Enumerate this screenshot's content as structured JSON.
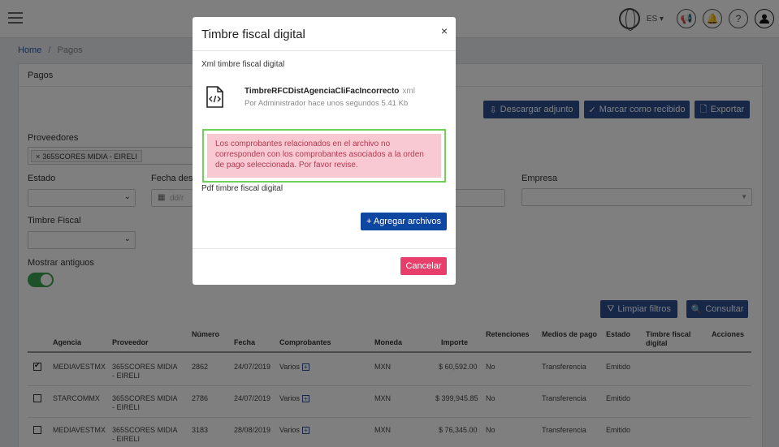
{
  "topbar": {
    "lang": "ES ▾",
    "lang_label": "ES"
  },
  "breadcrumb": {
    "home": "Home",
    "sep": "/",
    "current": "Pagos"
  },
  "panel": {
    "title": "Pagos"
  },
  "actions": {
    "download": "Descargar adjunto",
    "mark_received": "Marcar como recibido",
    "export": "Exportar"
  },
  "filters": {
    "proveedores_label": "Proveedores",
    "proveedor_tag": "365SCORES MIDIA - EIRELI",
    "estado_label": "Estado",
    "fecha_label": "Fecha desd",
    "fecha_placeholder": "dd/r",
    "empresa_label": "Empresa",
    "timbre_label": "Timbre Fiscal",
    "antiguos_label": "Mostrar antiguos",
    "limpiar": "Limpiar filtros",
    "consultar": "Consultar"
  },
  "table": {
    "headers": [
      "Agencia",
      "Proveedor",
      "Número",
      "Fecha",
      "Comprobantes",
      "Moneda",
      "Importe",
      "Retenciones",
      "Medios de pago",
      "Estado",
      "Timbre fiscal digital",
      "Acciones"
    ],
    "rows": [
      {
        "checked": true,
        "agencia": "MEDIAVESTMX",
        "proveedor": "365SCORES MIDIA - EIRELI",
        "numero": "2862",
        "fecha": "24/07/2019",
        "comprobantes": "Varios",
        "moneda": "MXN",
        "importe": "$ 60,592.00",
        "retenciones": "No",
        "medios": "Transferencia",
        "estado": "Emitido"
      },
      {
        "checked": false,
        "agencia": "STARCOMMX",
        "proveedor": "365SCORES MIDIA - EIRELI",
        "numero": "2786",
        "fecha": "24/07/2019",
        "comprobantes": "Varios",
        "moneda": "MXN",
        "importe": "$ 399,945.85",
        "retenciones": "No",
        "medios": "Transferencia",
        "estado": "Emitido"
      },
      {
        "checked": false,
        "agencia": "MEDIAVESTMX",
        "proveedor": "365SCORES MIDIA - EIRELI",
        "numero": "3183",
        "fecha": "28/08/2019",
        "comprobantes": "Varios",
        "moneda": "MXN",
        "importe": "$ 76,345.00",
        "retenciones": "No",
        "medios": "Transferencia",
        "estado": "Emitido"
      }
    ]
  },
  "modal": {
    "title": "Timbre fiscal digital",
    "close": "×",
    "xml_label": "Xml timbre fiscal digital",
    "file_name": "TimbreRFCDistAgenciaCliFacIncorrecto",
    "file_ext": "xml",
    "file_meta": "Por Administrador hace unos segundos  5.41 Kb",
    "error": "Los comprobantes relacionados en el archivo no corresponden con los comprobantes asociados a la orden de pago seleccionada. Por favor revise.",
    "pdf_label": "Pdf timbre fiscal digital",
    "add_files": "+ Agregar archivos",
    "cancel": "Cancelar"
  },
  "colors": {
    "primary": "#2c4f8f",
    "accent_blue": "#0d47a1",
    "danger": "#e83e6b",
    "error_bg": "#f8c8d3",
    "highlight": "#6ed25a",
    "toggle_on": "#3ba34e"
  }
}
